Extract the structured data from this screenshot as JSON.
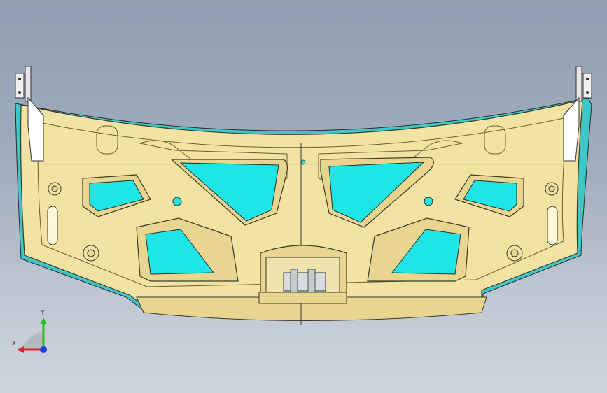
{
  "viewport": {
    "background_top": "#8f9db0",
    "background_bottom": "#cfd5de"
  },
  "part": {
    "body_color": "#f3e3a2",
    "edge_color": "#3a3a2a",
    "cutout_color": "#1ee6e6",
    "flange_color": "#3fc7c7"
  },
  "triad": {
    "x_label": "X",
    "y_label": "Y",
    "x_color": "#e02020",
    "y_color": "#20c020",
    "z_color": "#2040e0"
  }
}
